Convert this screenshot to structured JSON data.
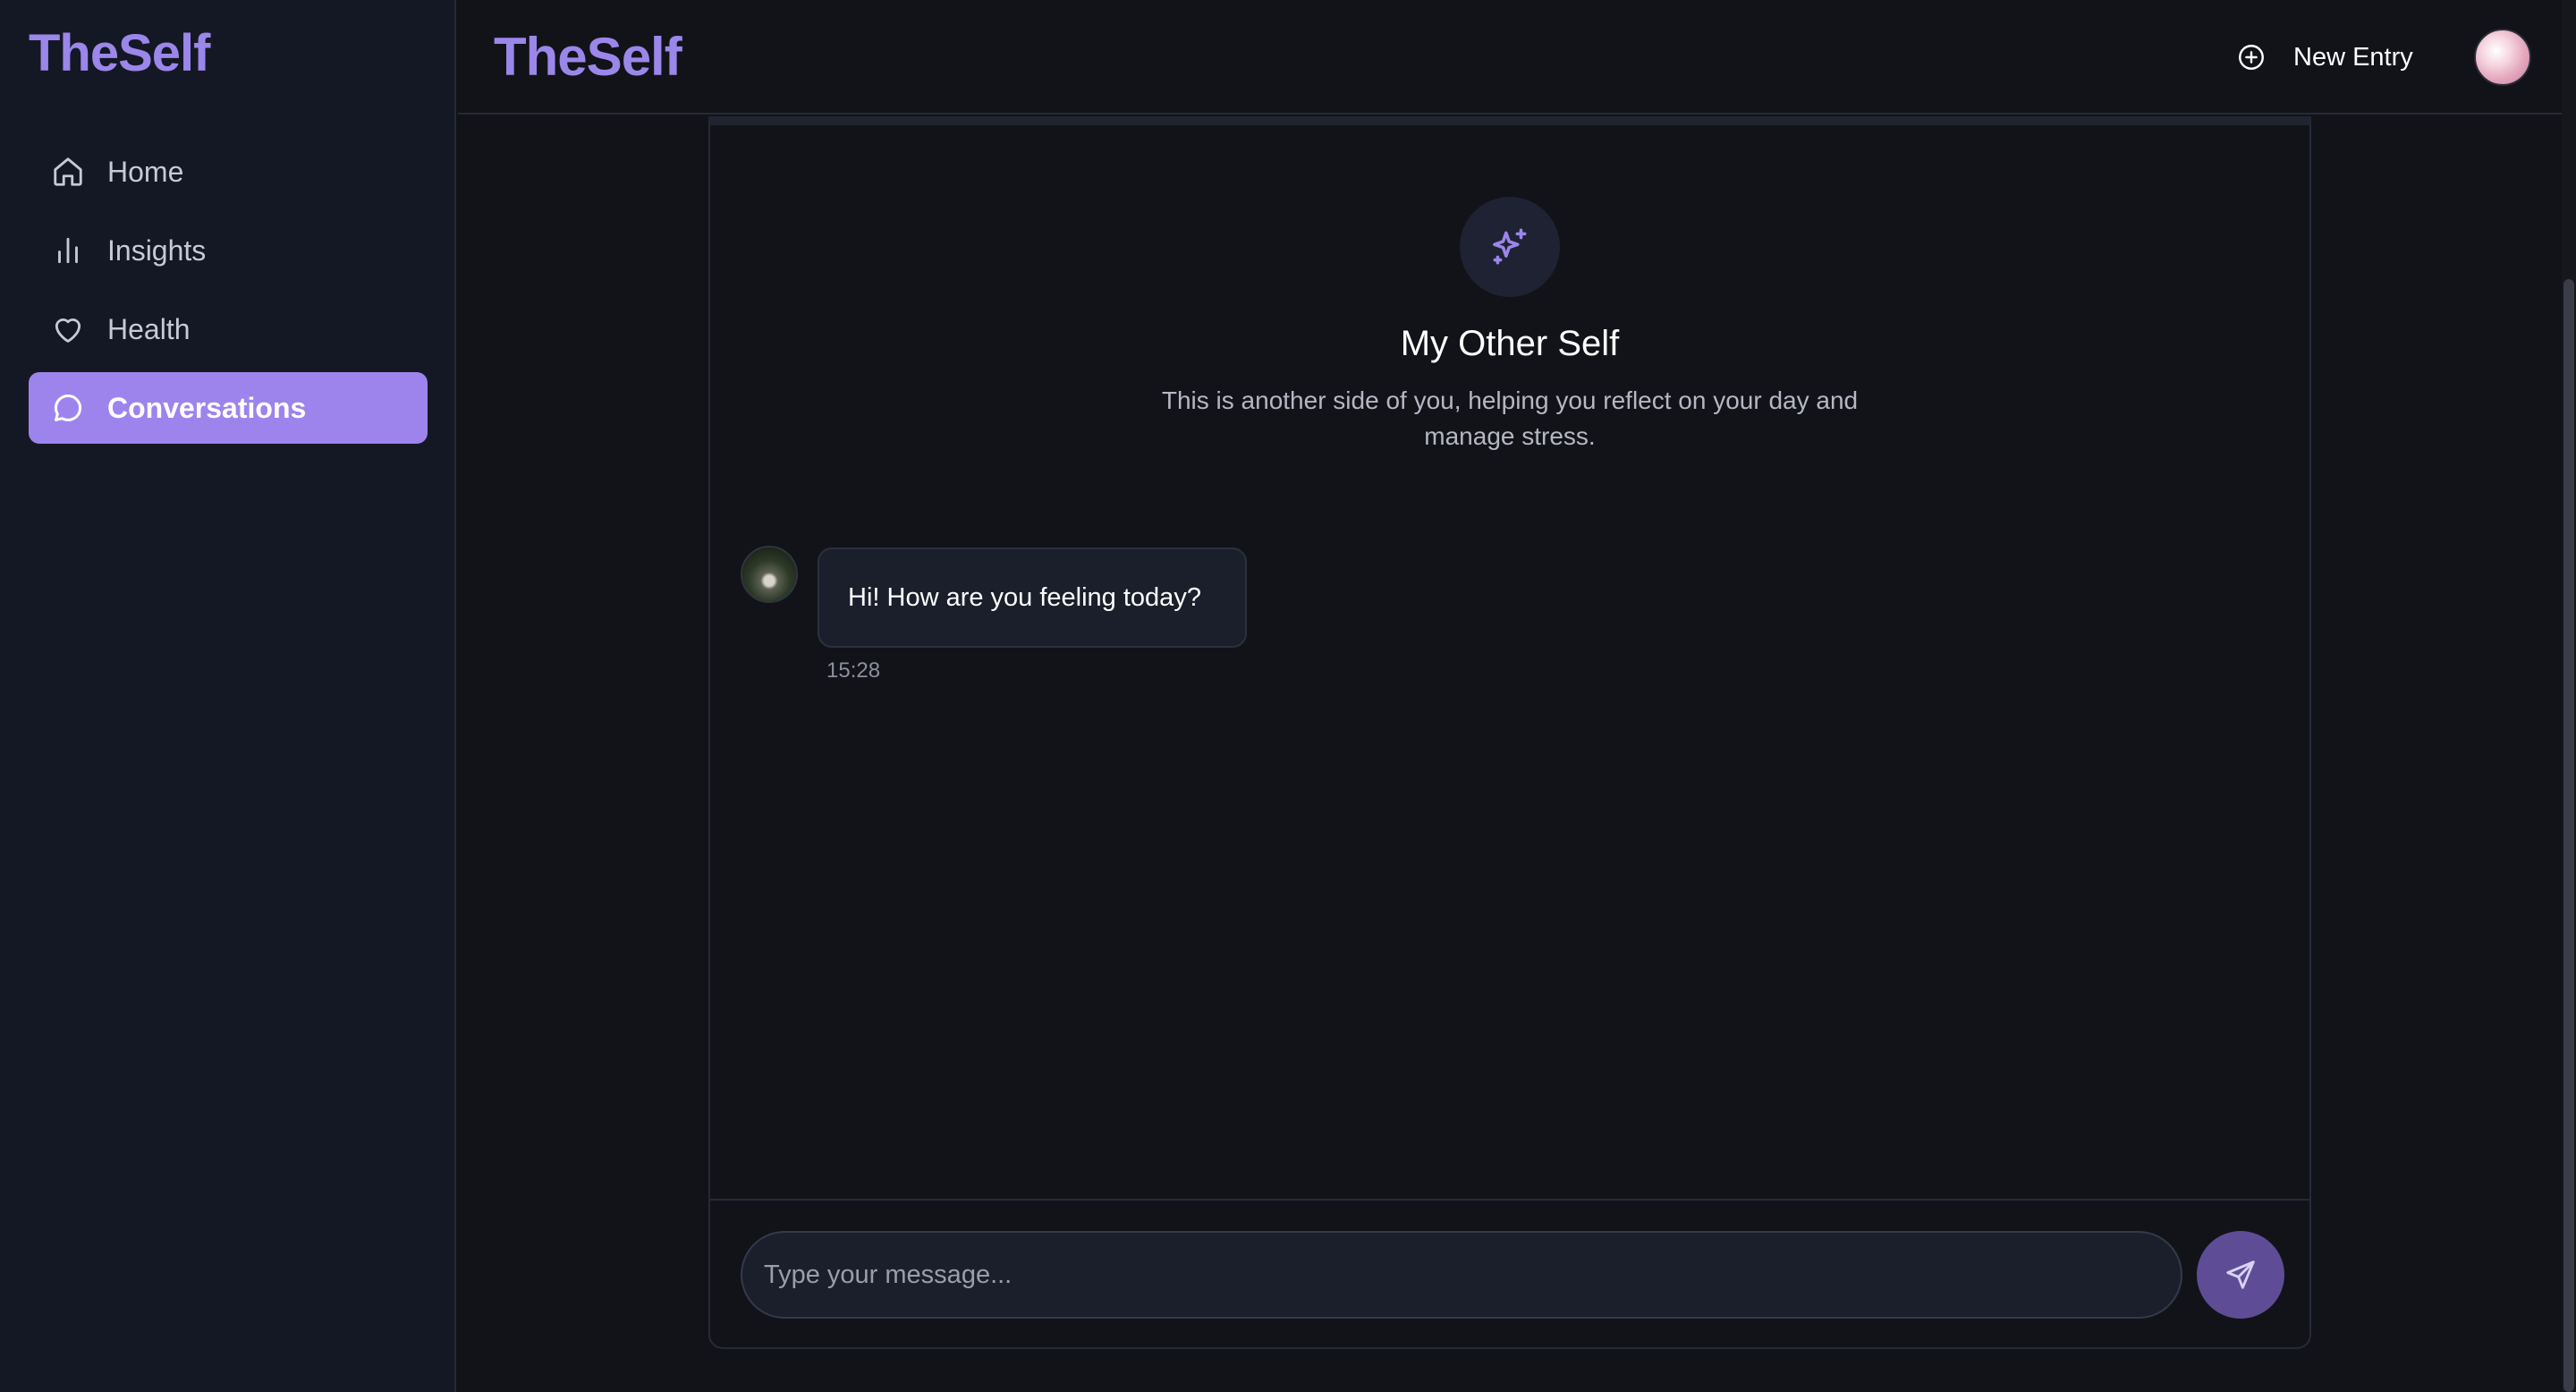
{
  "sidebar": {
    "brand": "TheSelf",
    "items": [
      {
        "label": "Home",
        "icon": "home-icon",
        "active": false
      },
      {
        "label": "Insights",
        "icon": "bar-chart-icon",
        "active": false
      },
      {
        "label": "Health",
        "icon": "heart-icon",
        "active": false
      },
      {
        "label": "Conversations",
        "icon": "chat-bubble-icon",
        "active": true
      }
    ]
  },
  "header": {
    "brand": "TheSelf",
    "new_entry_label": "New Entry",
    "new_entry_icon": "plus-circle-icon",
    "avatar_icon": "user-avatar"
  },
  "chat": {
    "header_icon": "sparkles-icon",
    "title": "My Other Self",
    "subtitle": "This is another side of you, helping you reflect on your day and manage stress.",
    "messages": [
      {
        "sender": "bot",
        "text": "Hi! How are you feeling today?",
        "time": "15:28"
      }
    ],
    "input": {
      "placeholder": "Type your message...",
      "value": ""
    },
    "send_icon": "send-icon"
  },
  "colors": {
    "accent": "#9b86ea",
    "active_nav_bg": "#9d84ec",
    "sidebar_bg": "#141824",
    "main_bg": "#121318",
    "bubble_bg": "#1b1f2c",
    "send_button_bg": "#5e4d96"
  }
}
